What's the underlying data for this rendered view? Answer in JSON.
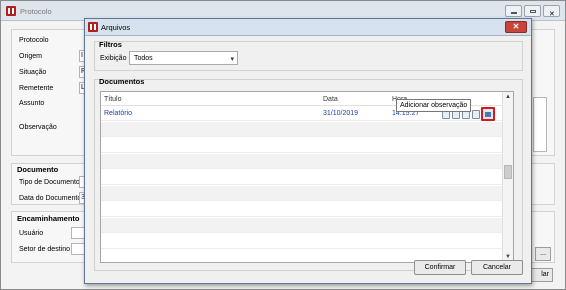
{
  "background_window": {
    "title": "Protocolo",
    "labels": {
      "protocolo": "Protocolo",
      "origem": "Origem",
      "situacao": "Situação",
      "remetente": "Remetente",
      "assunto": "Assunto",
      "observacao": "Observação"
    },
    "field_fragments": {
      "origem": "I",
      "situacao": "P",
      "remetente": "L",
      "data_documento": "3"
    },
    "documento_section": {
      "title": "Documento",
      "tipo_label": "Tipo de Documento",
      "data_label": "Data do Documento"
    },
    "encaminhamento_section": {
      "title": "Encaminhamento",
      "usuario_label": "Usuário",
      "setor_label": "Setor de destino"
    },
    "ellipsis_button": "...",
    "cancel_fragment": "lar"
  },
  "dialog": {
    "title": "Arquivos",
    "close_glyph": "✕",
    "filtros": {
      "title": "Filtros",
      "exibicao_label": "Exibição",
      "exibicao_value": "Todos"
    },
    "documentos": {
      "title": "Documentos",
      "columns": [
        "Título",
        "Data",
        "Hora"
      ],
      "rows": [
        {
          "titulo": "Relatório",
          "data": "31/10/2019",
          "hora": "14:15:27"
        }
      ]
    },
    "tooltip": "Adicionar observação",
    "buttons": {
      "confirm": "Confirmar",
      "cancel": "Cancelar"
    }
  },
  "colors": {
    "link_text": "#1f3fa8",
    "highlight_border": "#d21a1a",
    "close_button": "#c9453a"
  },
  "icons": [
    "app-logo-icon",
    "view-icon",
    "document-icon",
    "edit-icon",
    "attach-icon",
    "observation-icon",
    "scroll-up-icon",
    "scroll-down-icon",
    "dropdown-arrow-icon"
  ]
}
